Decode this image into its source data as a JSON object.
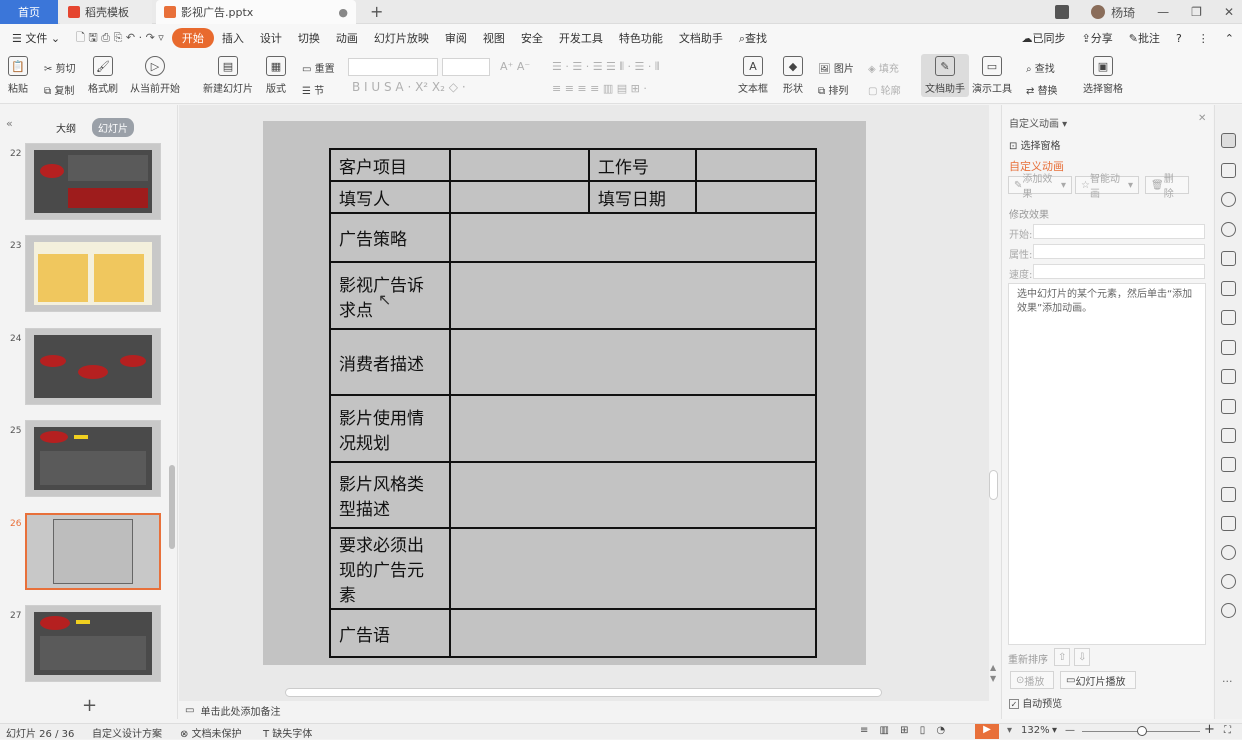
{
  "tabs": {
    "home": "首页",
    "template": "稻壳模板",
    "document": "影视广告.pptx"
  },
  "window": {
    "user": "杨琦"
  },
  "menu": {
    "file": "文件",
    "items": [
      "开始",
      "插入",
      "设计",
      "切换",
      "动画",
      "幻灯片放映",
      "审阅",
      "视图",
      "安全",
      "开发工具",
      "特色功能",
      "文档助手"
    ],
    "search": "查找",
    "sync": "已同步",
    "share": "分享",
    "annotate": "批注"
  },
  "ribbon": {
    "paste": "粘贴",
    "cut": "剪切",
    "copy": "复制",
    "format_painter": "格式刷",
    "play_from_current": "从当前开始",
    "new_slide": "新建幻灯片",
    "layout": "版式",
    "section": "节",
    "reset": "重置",
    "textbox": "文本框",
    "shape": "形状",
    "arrange": "排列",
    "picture": "图片",
    "outline": "轮廓",
    "fill": "填充",
    "doc_assistant": "文档助手",
    "presentation_tools": "演示工具",
    "find": "查找",
    "replace": "替换",
    "selection_pane": "选择窗格"
  },
  "left_pane": {
    "outline_tab": "大纲",
    "slides_tab": "幻灯片",
    "slides": [
      {
        "num": "22"
      },
      {
        "num": "23"
      },
      {
        "num": "24"
      },
      {
        "num": "25"
      },
      {
        "num": "26",
        "selected": true
      },
      {
        "num": "27"
      }
    ],
    "add": "+"
  },
  "slide_table": {
    "header_row1": [
      "客户项目",
      "",
      "工作号",
      ""
    ],
    "header_row2": [
      "填写人",
      "",
      "填写日期",
      ""
    ],
    "rows": [
      "广告策略",
      "影视广告诉求点",
      "消费者描述",
      "影片使用情况规划",
      "影片风格类型描述",
      "要求必须出现的广告元素",
      "广告语"
    ]
  },
  "right_pane": {
    "title": "自定义动画",
    "selection_pane": "选择窗格",
    "custom_animation": "自定义动画",
    "add_effect": "添加效果",
    "smart_animation": "智能动画",
    "delete": "删除",
    "modify_effect": "修改效果",
    "start_label": "开始:",
    "property_label": "属性:",
    "speed_label": "速度:",
    "hint": "选中幻灯片的某个元素，然后单击“添加效果”添加动画。",
    "reorder": "重新排序",
    "play": "播放",
    "slideshow": "幻灯片播放",
    "autopreview": "自动预览"
  },
  "notes_placeholder": "单击此处添加备注",
  "status": {
    "slide_counter": "幻灯片 26 / 36",
    "design": "自定义设计方案",
    "protect": "文档未保护",
    "missing_font": "缺失字体",
    "zoom": "132%"
  }
}
